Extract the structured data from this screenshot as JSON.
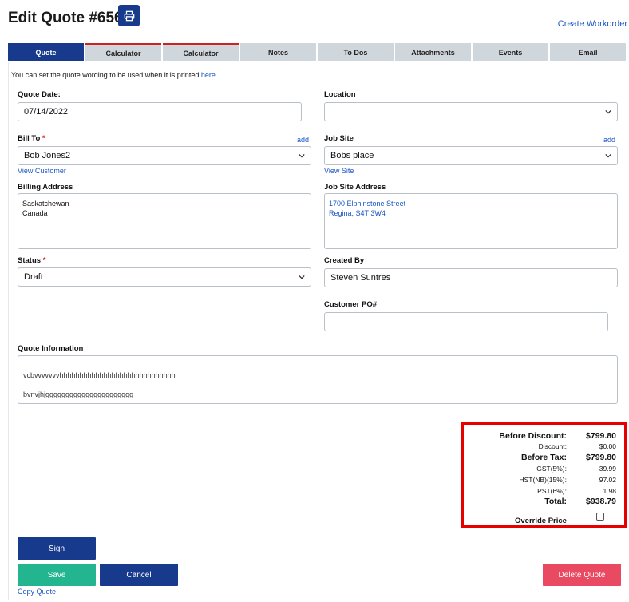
{
  "header": {
    "title": "Edit Quote #656",
    "create_workorder": "Create Workorder"
  },
  "tabs": [
    "Quote",
    "Calculator",
    "Calculator",
    "Notes",
    "To Dos",
    "Attachments",
    "Events",
    "Email"
  ],
  "info": {
    "text": "You can set the quote wording to be used when it is printed ",
    "link": "here",
    "end": "."
  },
  "form": {
    "quote_date": {
      "label": "Quote Date:",
      "value": "07/14/2022"
    },
    "location": {
      "label": "Location",
      "value": ""
    },
    "bill_to": {
      "label": "Bill To",
      "value": "Bob Jones2",
      "add": "add",
      "view": "View Customer"
    },
    "job_site": {
      "label": "Job Site",
      "value": "Bobs place",
      "add": "add",
      "view": "View Site"
    },
    "billing_address": {
      "label": "Billing Address",
      "line1": "Saskatchewan",
      "line2": "Canada"
    },
    "job_site_address": {
      "label": "Job Site Address",
      "line1": "1700 Elphinstone Street",
      "line2": "Regina, S4T 3W4"
    },
    "status": {
      "label": "Status",
      "value": "Draft"
    },
    "created_by": {
      "label": "Created By",
      "value": "Steven Suntres"
    },
    "customer_po": {
      "label": "Customer PO#",
      "value": ""
    },
    "quote_info": {
      "label": "Quote Information",
      "line1": "vcbvvvvvvvhhhhhhhhhhhhhhhhhhhhhhhhhhhhh",
      "line2": "bvnvjhjgggggggggggggggggggggg"
    },
    "required_mark": "*"
  },
  "totals": {
    "before_discount": {
      "label": "Before Discount:",
      "value": "$799.80"
    },
    "discount": {
      "label": "Discount:",
      "value": "$0.00"
    },
    "before_tax": {
      "label": "Before Tax:",
      "value": "$799.80"
    },
    "gst": {
      "label": "GST(5%):",
      "value": "39.99"
    },
    "hst": {
      "label": "HST(NB)(15%):",
      "value": "97.02"
    },
    "pst": {
      "label": "PST(6%):",
      "value": "1.98"
    },
    "total": {
      "label": "Total:",
      "value": "$938.79"
    },
    "override_price": "Override Price"
  },
  "buttons": {
    "sign": "Sign",
    "save": "Save",
    "cancel": "Cancel",
    "delete": "Delete Quote",
    "copy": "Copy Quote"
  },
  "colors": {
    "navy": "#173a8c",
    "green": "#23b590",
    "pink": "#ea4a61",
    "link": "#1a56c4",
    "highlight": "#e60000"
  },
  "icons": {
    "print": "printer-icon",
    "dropdown": "chevron-down-icon"
  }
}
